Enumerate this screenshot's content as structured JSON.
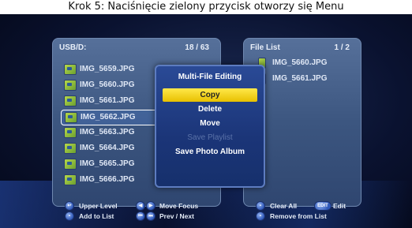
{
  "caption": "Krok 5: Naciśnięcie zielony przycisk otworzy się Menu",
  "left_panel": {
    "path": "USB/D:",
    "counter": "18 / 63",
    "files": [
      "IMG_5659.JPG",
      "IMG_5660.JPG",
      "IMG_5661.JPG",
      "IMG_5662.JPG",
      "IMG_5663.JPG",
      "IMG_5664.JPG",
      "IMG_5665.JPG",
      "IMG_5666.JPG"
    ],
    "selected_index": 3
  },
  "right_panel": {
    "title": "File List",
    "counter": "1 / 2",
    "files": [
      "IMG_5660.JPG",
      "IMG_5661.JPG"
    ]
  },
  "menu": {
    "title": "Multi-File Editing",
    "items": [
      {
        "label": "Copy",
        "state": "active"
      },
      {
        "label": "Delete",
        "state": "normal"
      },
      {
        "label": "Move",
        "state": "normal"
      },
      {
        "label": "Save Playlist",
        "state": "disabled"
      },
      {
        "label": "Save Photo Album",
        "state": "normal"
      }
    ]
  },
  "hints": {
    "upper_level": "Upper Level",
    "add_to_list": "Add to List",
    "move_focus": "Move Focus",
    "prev_next": "Prev / Next",
    "clear_all": "Clear All",
    "edit_button": "EDIT",
    "edit": "Edit",
    "remove_from_list": "Remove from List"
  },
  "colors": {
    "panel": "#3c5680",
    "menu_bg": "#1b3578",
    "active_item": "#ffe84a",
    "disabled_text": "#5a72a8"
  }
}
